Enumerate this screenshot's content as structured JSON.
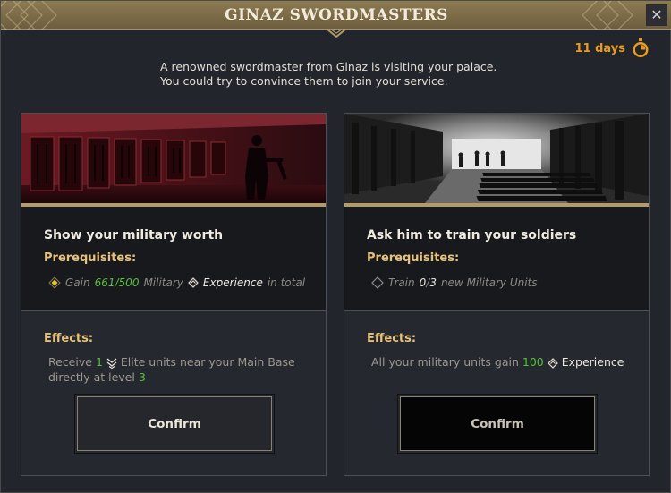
{
  "window": {
    "title": "GINAZ SWORDMASTERS"
  },
  "timer": {
    "label": "11 days",
    "icon": "stopwatch-icon"
  },
  "description": "A renowned swordmaster from Ginaz is visiting your palace. You could try to convince them to join your service.",
  "options": [
    {
      "title": "Show your military worth",
      "prerequisites_label": "Prerequisites:",
      "prereq": {
        "gain": "Gain",
        "current": "661",
        "sep": "/",
        "target": "500",
        "unit": "Military",
        "exp": "Experience",
        "suffix": "in total"
      },
      "effects_label": "Effects:",
      "effect": {
        "receive": "Receive",
        "count": "1",
        "mid": "Elite units near your Main Base directly at level",
        "level": "3"
      },
      "confirm": "Confirm"
    },
    {
      "title": "Ask him to train your soldiers",
      "prerequisites_label": "Prerequisites:",
      "prereq": {
        "train": "Train",
        "current": "0",
        "sep": "/",
        "target": "3",
        "unit": "new Military Units"
      },
      "effects_label": "Effects:",
      "effect": {
        "pre": "All your military units gain",
        "amount": "100",
        "exp": "Experience"
      },
      "confirm": "Confirm"
    }
  ],
  "colors": {
    "gold": "#e7c27a",
    "green": "#57c23a",
    "timer": "#e89b22"
  }
}
